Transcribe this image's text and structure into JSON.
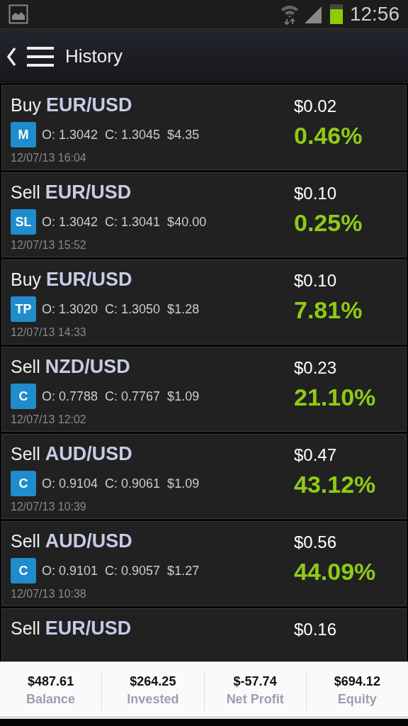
{
  "status_bar": {
    "time": "12:56"
  },
  "header": {
    "title": "History"
  },
  "trades": [
    {
      "side": "Buy",
      "pair": "EUR/USD",
      "badge": "M",
      "details": "O: 1.3042  C: 1.3045  $4.35",
      "date": "12/07/13 16:04",
      "amount": "$0.02",
      "percent": "0.46%"
    },
    {
      "side": "Sell",
      "pair": "EUR/USD",
      "badge": "SL",
      "details": "O: 1.3042  C: 1.3041  $40.00",
      "date": "12/07/13 15:52",
      "amount": "$0.10",
      "percent": "0.25%"
    },
    {
      "side": "Buy",
      "pair": "EUR/USD",
      "badge": "TP",
      "details": "O: 1.3020  C: 1.3050  $1.28",
      "date": "12/07/13 14:33",
      "amount": "$0.10",
      "percent": "7.81%"
    },
    {
      "side": "Sell",
      "pair": "NZD/USD",
      "badge": "C",
      "details": "O: 0.7788  C: 0.7767  $1.09",
      "date": "12/07/13 12:02",
      "amount": "$0.23",
      "percent": "21.10%"
    },
    {
      "side": "Sell",
      "pair": "AUD/USD",
      "badge": "C",
      "details": "O: 0.9104  C: 0.9061  $1.09",
      "date": "12/07/13 10:39",
      "amount": "$0.47",
      "percent": "43.12%"
    },
    {
      "side": "Sell",
      "pair": "AUD/USD",
      "badge": "C",
      "details": "O: 0.9101  C: 0.9057  $1.27",
      "date": "12/07/13 10:38",
      "amount": "$0.56",
      "percent": "44.09%"
    },
    {
      "side": "Sell",
      "pair": "EUR/USD",
      "amount": "$0.16"
    }
  ],
  "summary": [
    {
      "value": "$487.61",
      "label": "Balance"
    },
    {
      "value": "$264.25",
      "label": "Invested"
    },
    {
      "value": "$-57.74",
      "label": "Net Profit"
    },
    {
      "value": "$694.12",
      "label": "Equity"
    }
  ]
}
